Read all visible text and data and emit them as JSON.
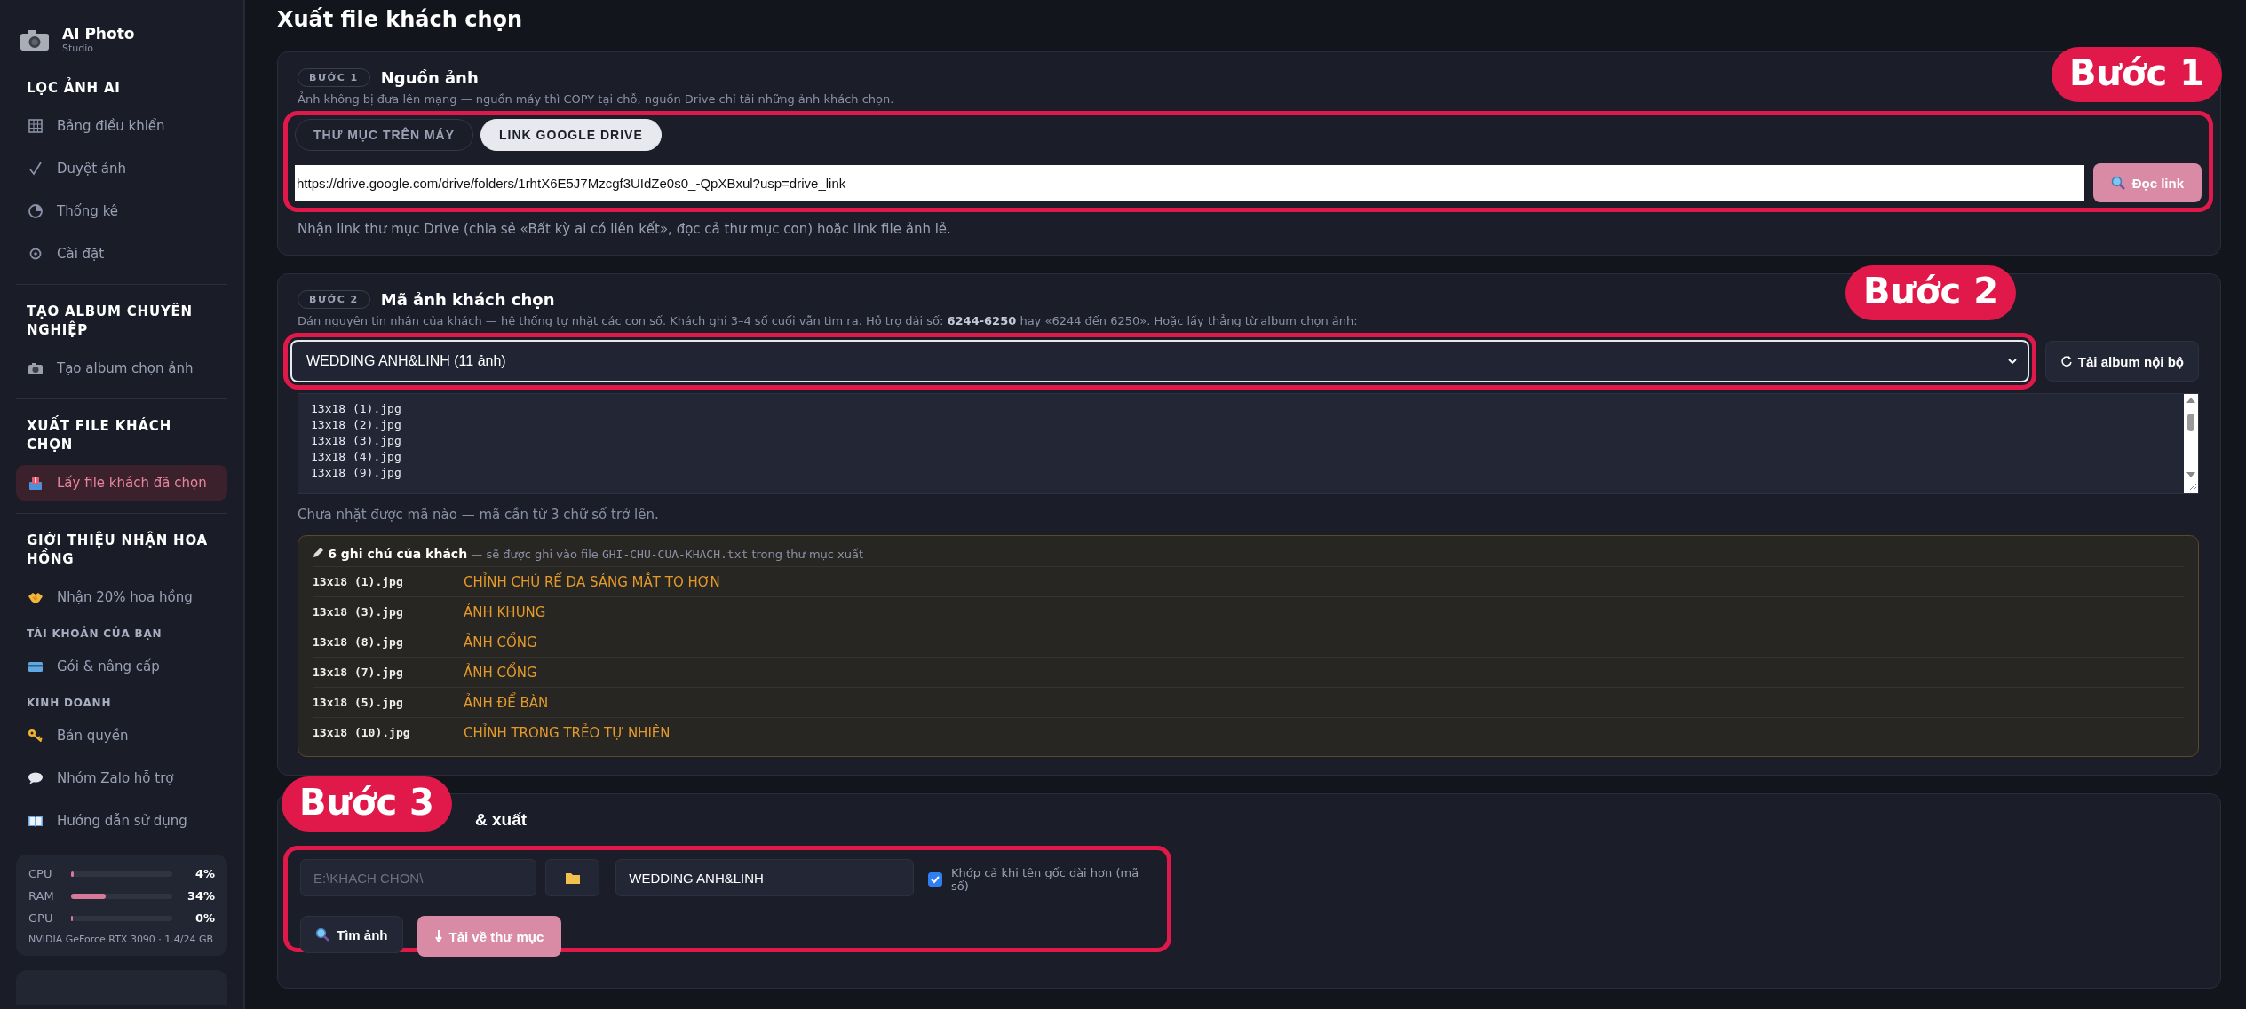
{
  "sidebar": {
    "brand": {
      "title": "AI Photo",
      "subtitle": "Studio"
    },
    "sections": [
      {
        "title": "LỌC ẢNH AI",
        "kind": "major",
        "items": [
          {
            "label": "Bảng điều khiển",
            "selected": false
          },
          {
            "label": "Duyệt ảnh",
            "selected": false
          },
          {
            "label": "Thống kê",
            "selected": false
          },
          {
            "label": "Cài đặt",
            "selected": false
          }
        ]
      },
      {
        "title": "TẠO ALBUM CHUYÊN NGHIỆP",
        "kind": "major",
        "items": [
          {
            "label": "Tạo album chọn ảnh",
            "selected": false
          }
        ]
      },
      {
        "title": "XUẤT FILE KHÁCH CHỌN",
        "kind": "major",
        "items": [
          {
            "label": "Lấy file khách đã chọn",
            "selected": true
          }
        ]
      },
      {
        "title": "GIỚI THIỆU NHẬN HOA HỒNG",
        "kind": "major",
        "items": [
          {
            "label": "Nhận 20% hoa hồng",
            "selected": false
          }
        ]
      },
      {
        "title": "TÀI KHOẢN CỦA BẠN",
        "kind": "minor",
        "items": [
          {
            "label": "Gói & nâng cấp",
            "selected": false
          }
        ]
      },
      {
        "title": "KINH DOANH",
        "kind": "minor",
        "items": [
          {
            "label": "Bản quyền",
            "selected": false
          },
          {
            "label": "Nhóm Zalo hỗ trợ",
            "selected": false
          },
          {
            "label": "Hướng dẫn sử dụng",
            "selected": false
          }
        ]
      }
    ],
    "stats": {
      "meters": [
        {
          "name": "CPU",
          "level": 0.03,
          "reading": "4%"
        },
        {
          "name": "RAM",
          "level": 0.34,
          "reading": "34%"
        },
        {
          "name": "GPU",
          "level": 0,
          "reading": "0%"
        }
      ],
      "gpu": "NVIDIA GeForce RTX 3090 · 1.4/24 GB"
    }
  },
  "page_title": "Xuất file khách chọn",
  "step1": {
    "badge": "BƯỚC 1",
    "title": "Nguồn ảnh",
    "description": "Ảnh không bị đưa lên mạng — nguồn máy thì COPY tại chỗ, nguồn Drive chỉ tải những ảnh khách chọn.",
    "callout": "Bước 1",
    "tabs": [
      {
        "label": "THƯ MỤC TRÊN MÁY",
        "selected": false
      },
      {
        "label": "LINK GOOGLE DRIVE",
        "selected": true
      }
    ],
    "url": "https://drive.google.com/drive/folders/1rhtX6E5J7Mzcgf3UIdZe0s0_-QpXBxul?usp=drive_link",
    "button": "Đọc link",
    "hint": "Nhận link thư mục Drive (chia sẻ «Bất kỳ ai có liên kết», đọc cả thư mục con) hoặc link file ảnh lẻ."
  },
  "step2": {
    "badge": "BƯỚC 2",
    "title": "Mã ảnh khách chọn",
    "callout": "Bước 2",
    "description": "Dán nguyên tin nhắn của khách — hệ thống tự nhặt các con số. Khách ghi 3–4 số cuối vẫn tìm ra. Hỗ trợ dải số: **6244-6250** hay «6244 đến 6250». Hoặc lấy thẳng từ album chọn ảnh:",
    "album": "WEDDING ANH&LINH (11 ảnh)",
    "reload_button": "Tải album nội bộ",
    "codes": [
      "13x18 (1).jpg",
      "13x18 (2).jpg",
      "13x18 (3).jpg",
      "13x18 (4).jpg",
      "13x18 (9).jpg"
    ],
    "status": "Chưa nhặt được mã nào — mã cần từ 3 chữ số trở lên.",
    "notes": {
      "title": "6 ghi chú của khách",
      "text_before": "— sẽ được ghi vào file",
      "file": "GHI-CHU-CUA-KHACH.txt",
      "text_after": "trong thư mục xuất",
      "rows": [
        {
          "file": "13x18 (1).jpg",
          "note": "CHỈNH CHÚ RỂ DA SÁNG MẮT TO HƠN"
        },
        {
          "file": "13x18 (3).jpg",
          "note": "ẢNH KHUNG"
        },
        {
          "file": "13x18 (8).jpg",
          "note": "ẢNH CỔNG"
        },
        {
          "file": "13x18 (7).jpg",
          "note": "ẢNH CỔNG"
        },
        {
          "file": "13x18 (5).jpg",
          "note": "ẢNH ĐỂ BÀN"
        },
        {
          "file": "13x18 (10).jpg",
          "note": "CHỈNH TRONG TRẺO TỰ NHIÊN"
        }
      ]
    }
  },
  "step3": {
    "title": "& xuất",
    "callout": "Bước 3",
    "folder": {
      "placeholder": "E:\\KHACH CHON\\"
    },
    "customer": "WEDDING ANH&LINH",
    "match": {
      "label": "Khớp cả khi tên gốc dài hơn (mã số)",
      "checked": true
    },
    "buttons": [
      {
        "label": "Tìm ảnh",
        "kind": "search"
      },
      {
        "label": "Tải về thư mục",
        "kind": "download"
      }
    ]
  }
}
